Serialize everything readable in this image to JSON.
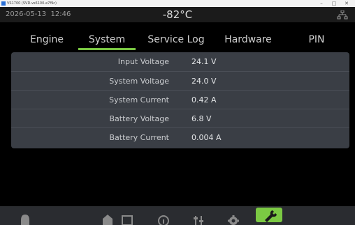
{
  "window": {
    "title": "VS1700 (SVD-vs6100-e7f9c)",
    "controls": [
      "–",
      "□",
      "✕"
    ]
  },
  "status": {
    "date": "2026-05-13",
    "time": "12:46",
    "temperature": "-82°C"
  },
  "tabs": [
    "Engine",
    "System",
    "Service Log",
    "Hardware",
    "PIN"
  ],
  "active_tab": "System",
  "system": {
    "rows": [
      {
        "label": "Input Voltage",
        "value": "24.1 V"
      },
      {
        "label": "System Voltage",
        "value": "24.0 V"
      },
      {
        "label": "System Current",
        "value": "0.42 A"
      },
      {
        "label": "Battery Voltage",
        "value": "6.8 V"
      },
      {
        "label": "Battery Current",
        "value": "0.004 A"
      }
    ]
  },
  "bottom_nav": {
    "items": [
      "bell-icon",
      "home-icon",
      "square-icon",
      "info-icon",
      "sliders-icon",
      "gear-icon",
      "wrench-icon"
    ],
    "active": "wrench-icon",
    "accent": "#7bc943"
  }
}
